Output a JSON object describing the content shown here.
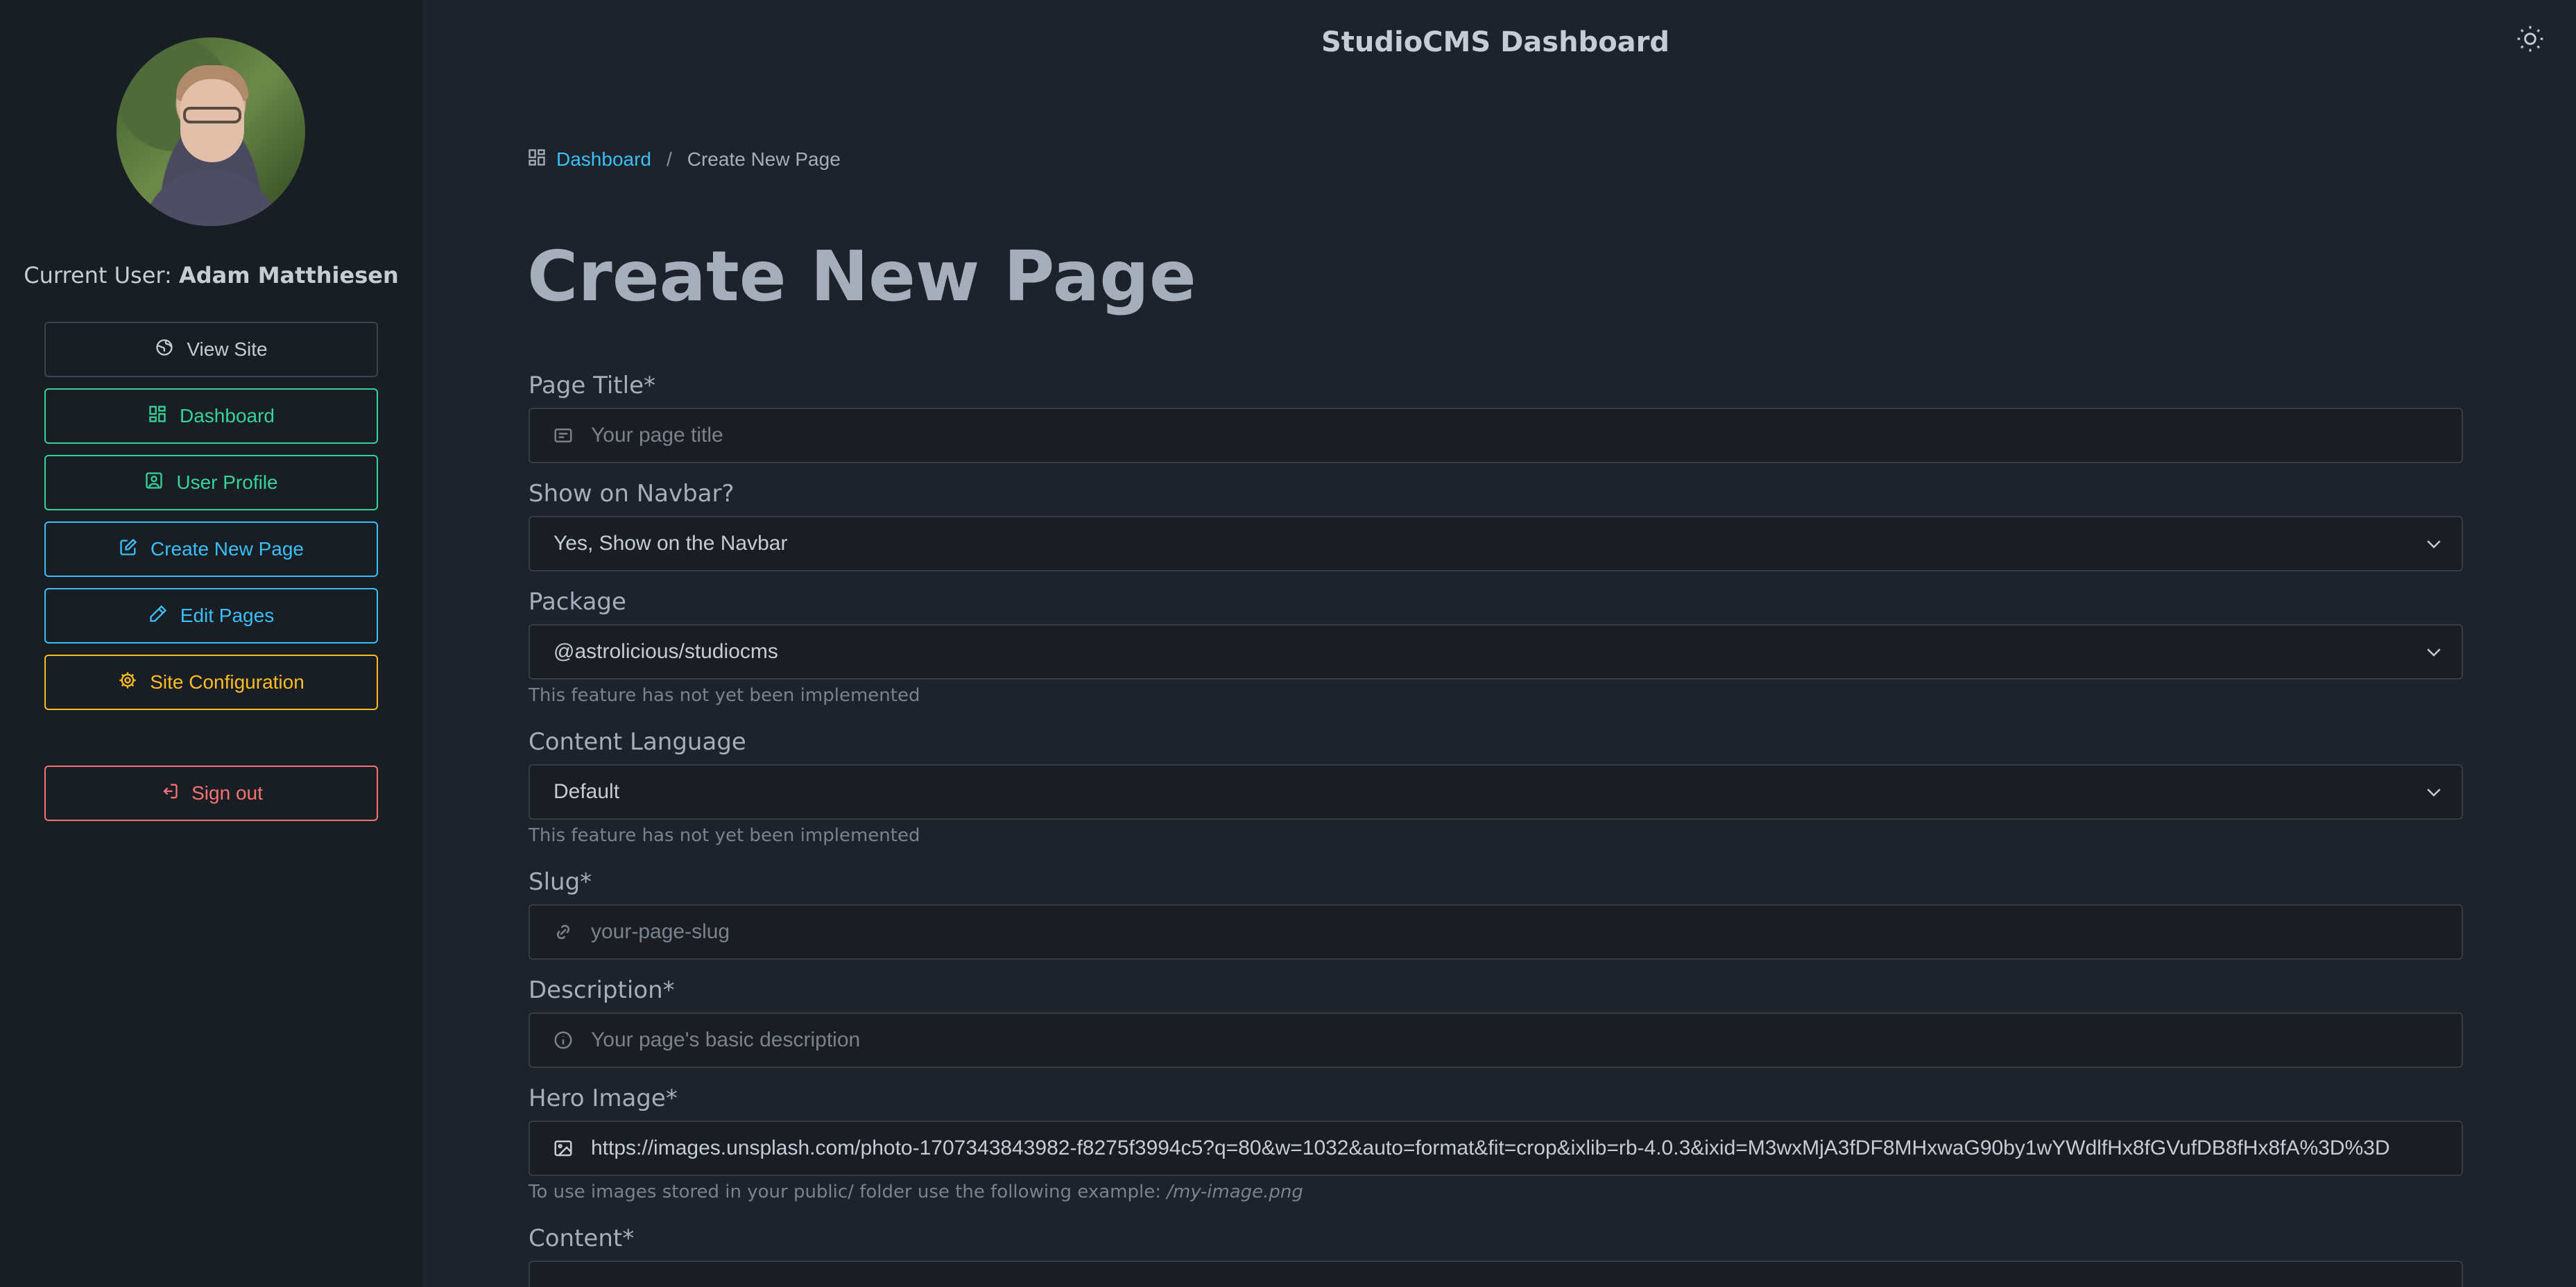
{
  "header": {
    "title": "StudioCMS Dashboard"
  },
  "sidebar": {
    "current_user_label": "Current User:",
    "current_user_name": "Adam Matthiesen",
    "items": [
      {
        "label": "View Site",
        "icon": "globe-icon"
      },
      {
        "label": "Dashboard",
        "icon": "dashboard-icon"
      },
      {
        "label": "User Profile",
        "icon": "user-profile-icon"
      },
      {
        "label": "Create New Page",
        "icon": "edit-square-icon"
      },
      {
        "label": "Edit Pages",
        "icon": "pencil-icon"
      },
      {
        "label": "Site Configuration",
        "icon": "gear-icon"
      },
      {
        "label": "Sign out",
        "icon": "sign-out-icon"
      }
    ]
  },
  "breadcrumb": {
    "link": "Dashboard",
    "separator": "/",
    "current": "Create New Page"
  },
  "page": {
    "title": "Create New Page"
  },
  "form": {
    "page_title": {
      "label": "Page Title",
      "required": "*",
      "placeholder": "Your page title"
    },
    "show_on_navbar": {
      "label": "Show on Navbar?",
      "value": "Yes, Show on the Navbar"
    },
    "package": {
      "label": "Package",
      "value": "@astrolicious/studiocms",
      "hint": "This feature has not yet been implemented"
    },
    "content_language": {
      "label": "Content Language",
      "value": "Default",
      "hint": "This feature has not yet been implemented"
    },
    "slug": {
      "label": "Slug",
      "required": "*",
      "placeholder": "your-page-slug"
    },
    "description": {
      "label": "Description",
      "required": "*",
      "placeholder": "Your page's basic description"
    },
    "hero_image": {
      "label": "Hero Image",
      "required": "*",
      "value": "https://images.unsplash.com/photo-1707343843982-f8275f3994c5?q=80&w=1032&auto=format&fit=crop&ixlib=rb-4.0.3&ixid=M3wxMjA3fDF8MHxwaG90by1wYWdlfHx8fGVufDB8fHx8fA%3D%3D",
      "hint_prefix": "To use images stored in your public/ folder use the following example:",
      "hint_example": "/my-image.png"
    },
    "content": {
      "label": "Content",
      "required": "*"
    }
  },
  "colors": {
    "background": "#1d232a",
    "sidebar": "#191e24",
    "green": "#36d399",
    "blue": "#3abff8",
    "yellow": "#fbbd23",
    "red": "#f87272"
  }
}
